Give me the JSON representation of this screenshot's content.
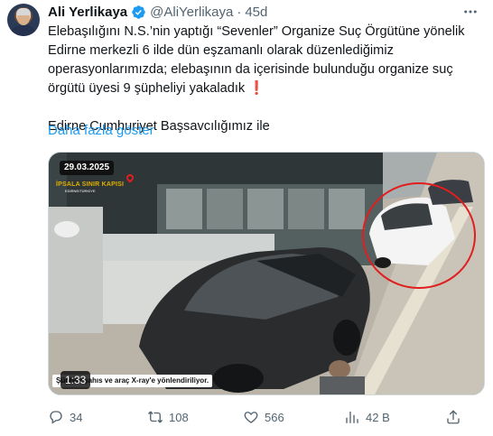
{
  "author": {
    "name": "Ali Yerlikaya",
    "handle": "@AliYerlikaya",
    "separator": "·",
    "time": "45d"
  },
  "tweet": {
    "line1": "Elebaşılığını N.S.’nin yaptığı “Sevenler” Organize Suç Örgütüne yönelik",
    "line2": "Edirne merkezli 6 ilde dün eşzamanlı olarak düzenlediğimiz",
    "line3": "operasyonlarımızda; elebaşının da içerisinde bulunduğu organize suç",
    "line4": "örgütü üyesi 9 şüpheliyi yakaladık",
    "exclaim": "❗",
    "line5": "Edirne Cumhuriyet Başsavcılığımız ile",
    "show_more": "Daha fazla göster"
  },
  "media": {
    "date": "29.03.2025",
    "location": "İPSALA SINIR KAPISI",
    "location_sub": "EDİRNE/TÜRKİYE",
    "duration": "1:33",
    "caption": "Şüpheli şahıs ve araç X-ray'e yönlendiriliyor."
  },
  "actions": {
    "replies": "34",
    "reposts": "108",
    "likes": "566",
    "views": "42 B"
  },
  "colors": {
    "link": "#1d9bf0",
    "muted": "#536471",
    "verified": "#1d9bf0",
    "highlight_circle": "#e01e1e"
  },
  "icons": {
    "verified": "verified-badge-icon",
    "more": "more-dots-icon",
    "reply": "reply-icon",
    "repost": "repost-icon",
    "like": "heart-icon",
    "views": "views-bar-chart-icon",
    "share": "share-icon"
  }
}
